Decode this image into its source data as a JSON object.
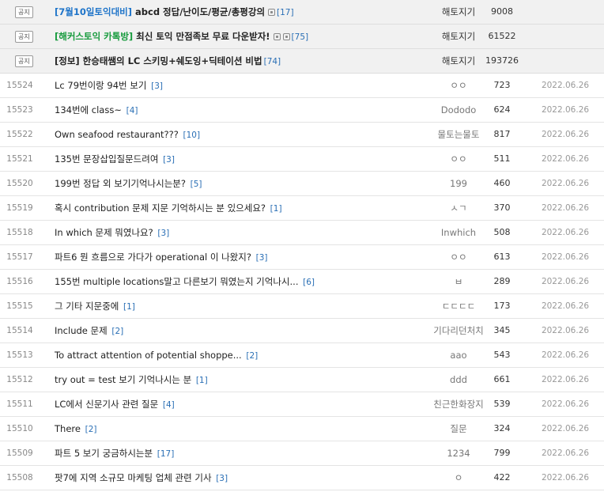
{
  "notices": [
    {
      "badge": "공지",
      "category": "[7월10일토익대비]",
      "category_color": "blue",
      "title": " abcd 정답/난이도/평균/총평강의",
      "icons": [
        "image-icon"
      ],
      "comments": "[17]",
      "author": "해토지기",
      "views": "9008"
    },
    {
      "badge": "공지",
      "category": "[해커스토익 카톡방]",
      "category_color": "green",
      "title": " 최신 토익 만점족보 무료 다운받자!",
      "icons": [
        "image-icon",
        "file-icon"
      ],
      "comments": "[75]",
      "author": "해토지기",
      "views": "61522"
    },
    {
      "badge": "공지",
      "category": "",
      "category_color": "",
      "title": "[정보] 한승태쌤의 LC 스키밍+쉐도잉+딕테이션 비법",
      "icons": [],
      "comments": "[74]",
      "author": "해토지기",
      "views": "193726"
    }
  ],
  "posts": [
    {
      "num": "15524",
      "title": "Lc 79번이랑 94번 보기",
      "comments": "[3]",
      "author": "ㅇㅇ",
      "views": "723",
      "date": "2022.06.26"
    },
    {
      "num": "15523",
      "title": "134번에 class~",
      "comments": "[4]",
      "author": "Dododo",
      "views": "624",
      "date": "2022.06.26"
    },
    {
      "num": "15522",
      "title": "Own seafood restaurant???",
      "comments": "[10]",
      "author": "물토는물토",
      "views": "817",
      "date": "2022.06.26"
    },
    {
      "num": "15521",
      "title": "135번 문장삽입질문드려여",
      "comments": "[3]",
      "author": "ㅇㅇ",
      "views": "511",
      "date": "2022.06.26"
    },
    {
      "num": "15520",
      "title": "199번 정답 외 보기기억나시는분?",
      "comments": "[5]",
      "author": "199",
      "views": "460",
      "date": "2022.06.26"
    },
    {
      "num": "15519",
      "title": "혹시 contribution 문제 지문 기억하시는 분 있으세요?",
      "comments": "[1]",
      "author": "ㅅㄱ",
      "views": "370",
      "date": "2022.06.26"
    },
    {
      "num": "15518",
      "title": "In which 문제 뭐였나요?",
      "comments": "[3]",
      "author": "Inwhich",
      "views": "508",
      "date": "2022.06.26"
    },
    {
      "num": "15517",
      "title": "파트6 뭔 흐름으로 가다가 operational 이 나왔지?",
      "comments": "[3]",
      "author": "ㅇㅇ",
      "views": "613",
      "date": "2022.06.26"
    },
    {
      "num": "15516",
      "title": "155번 multiple locations말고 다른보기 뭐였는지 기억나시...",
      "comments": "[6]",
      "author": "ㅂ",
      "views": "289",
      "date": "2022.06.26"
    },
    {
      "num": "15515",
      "title": "그 기타 지문중에",
      "comments": "[1]",
      "author": "ㄷㄷㄷㄷ",
      "views": "173",
      "date": "2022.06.26"
    },
    {
      "num": "15514",
      "title": "Include 문제",
      "comments": "[2]",
      "author": "기다리던처치",
      "views": "345",
      "date": "2022.06.26"
    },
    {
      "num": "15513",
      "title": "To attract attention of potential shoppe...",
      "comments": "[2]",
      "author": "aao",
      "views": "543",
      "date": "2022.06.26"
    },
    {
      "num": "15512",
      "title": "try out = test 보기 기억나시는 분",
      "comments": "[1]",
      "author": "ddd",
      "views": "661",
      "date": "2022.06.26"
    },
    {
      "num": "15511",
      "title": "LC에서 신문기사 관련 질문",
      "comments": "[4]",
      "author": "친근한화장지",
      "views": "539",
      "date": "2022.06.26"
    },
    {
      "num": "15510",
      "title": "There",
      "comments": "[2]",
      "author": "질문",
      "views": "324",
      "date": "2022.06.26"
    },
    {
      "num": "15509",
      "title": "파트 5 보기 궁금하시는분",
      "comments": "[17]",
      "author": "1234",
      "views": "799",
      "date": "2022.06.26"
    },
    {
      "num": "15508",
      "title": "팟7에 지역 소규모 마케팅 업체 관련 기사",
      "comments": "[3]",
      "author": "ㅇ",
      "views": "422",
      "date": "2022.06.26"
    }
  ],
  "colors": {
    "category_blue": "#1e74c9",
    "category_green": "#169a3c",
    "comment_count": "#2a6fb5",
    "notice_bg": "#f1f1f1"
  }
}
